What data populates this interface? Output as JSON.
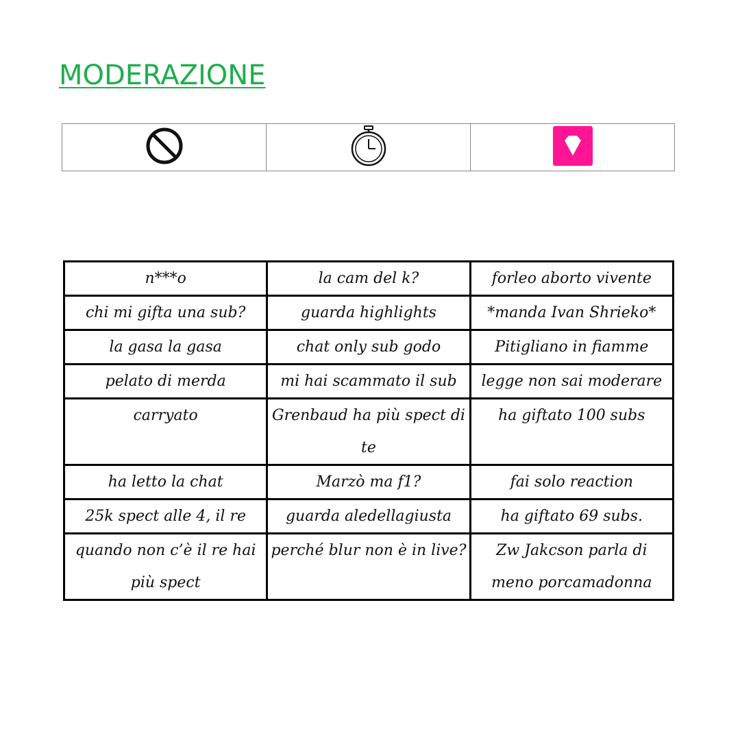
{
  "title": {
    "text": "MODERAZIONE",
    "color": "#1fae4d"
  },
  "icons": [
    {
      "name": "ban-icon"
    },
    {
      "name": "stopwatch-icon"
    },
    {
      "name": "diamond-icon",
      "color": "#ff1493"
    }
  ],
  "phrases": [
    [
      "n***o",
      "la cam del k?",
      "forleo aborto vivente"
    ],
    [
      "chi mi gifta una sub?",
      "guarda highlights",
      "*manda Ivan Shrieko*"
    ],
    [
      "la gasa la gasa",
      "chat only sub godo",
      "Pitigliano in fiamme"
    ],
    [
      "pelato di merda",
      "mi hai scammato il sub",
      "legge non sai moderare"
    ],
    [
      "carryato",
      "Grenbaud ha più spect di te",
      "ha giftato 100 subs"
    ],
    [
      "ha letto la chat",
      "Marzò ma f1?",
      "fai solo reaction"
    ],
    [
      "25k spect alle 4, il re",
      "guarda aledellagiusta",
      "ha giftato 69 subs."
    ],
    [
      "quando non c’è il re hai più spect",
      "perché blur non è in live?",
      "Zw Jakcson parla di meno porcamadonna"
    ]
  ]
}
